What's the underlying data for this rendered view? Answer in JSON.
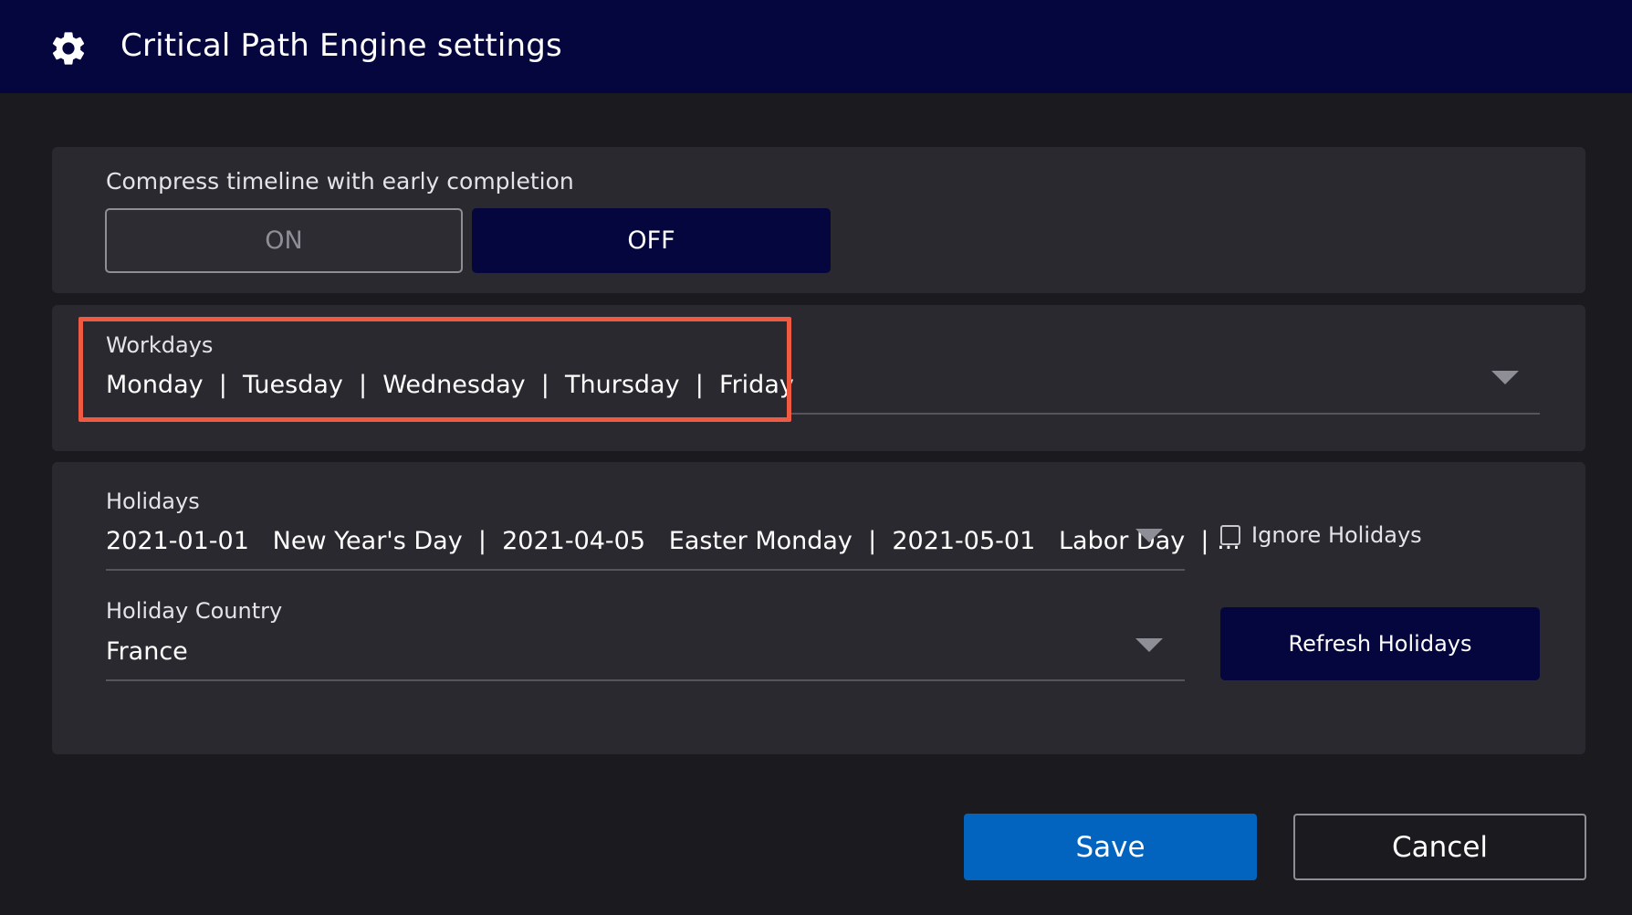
{
  "dialog": {
    "title": "Critical Path Engine settings",
    "title_icon": "gear-icon"
  },
  "compress": {
    "label": "Compress timeline with early completion",
    "on_label": "ON",
    "off_label": "OFF",
    "selected": "OFF"
  },
  "workdays": {
    "label": "Workdays",
    "value": "Monday  |  Tuesday  |  Wednesday  |  Thursday  |  Friday",
    "dropdown_icon": "caret-down-icon"
  },
  "holidays": {
    "label": "Holidays",
    "value": "2021-01-01   New Year's Day  |  2021-04-05   Easter Monday  |  2021-05-01   Labor Day  | ...",
    "ignore_label": "Ignore Holidays",
    "ignore_checked": false,
    "country_label": "Holiday Country",
    "country_value": "France",
    "refresh_label": "Refresh Holidays"
  },
  "footer": {
    "save_label": "Save",
    "cancel_label": "Cancel"
  },
  "colors": {
    "title_bar": "#05063d",
    "panel": "#29292f",
    "background": "#1b1b1f",
    "primary": "#0264bf",
    "highlight": "#ef5a43"
  }
}
